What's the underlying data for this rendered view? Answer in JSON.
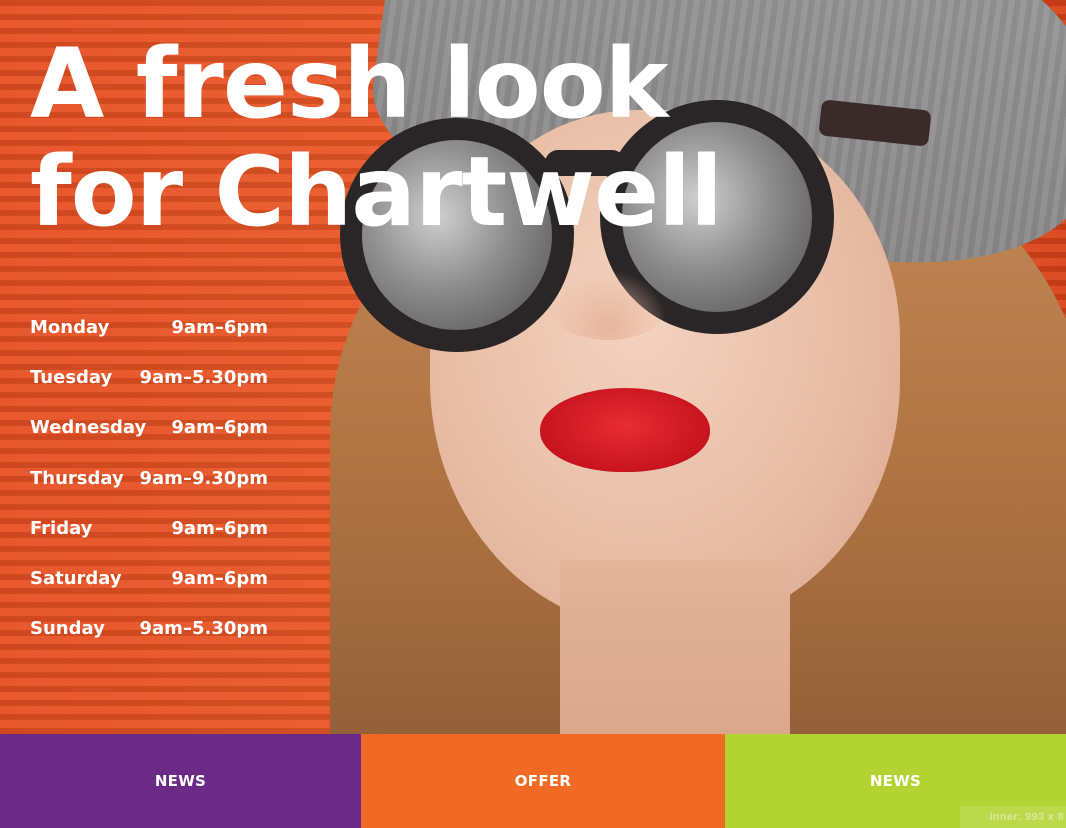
{
  "hero": {
    "headline_line1": "A fresh look",
    "headline_line2": "for Chartwell"
  },
  "opening_hours": [
    {
      "day": "Monday",
      "time": "9am–6pm"
    },
    {
      "day": "Tuesday",
      "time": "9am–5.30pm"
    },
    {
      "day": "Wednesday",
      "time": "9am–6pm"
    },
    {
      "day": "Thursday",
      "time": "9am–9.30pm"
    },
    {
      "day": "Friday",
      "time": "9am–6pm"
    },
    {
      "day": "Saturday",
      "time": "9am–6pm"
    },
    {
      "day": "Sunday",
      "time": "9am–5.30pm"
    }
  ],
  "tiles": [
    {
      "label": "NEWS",
      "color": "#6a2a85"
    },
    {
      "label": "OFFER",
      "color": "#f06a23"
    },
    {
      "label": "NEWS",
      "color": "#b3d333"
    }
  ],
  "overlay_note": "Inner: 993 x 8",
  "colors": {
    "hero_background": "#e6521f",
    "text": "#ffffff"
  }
}
